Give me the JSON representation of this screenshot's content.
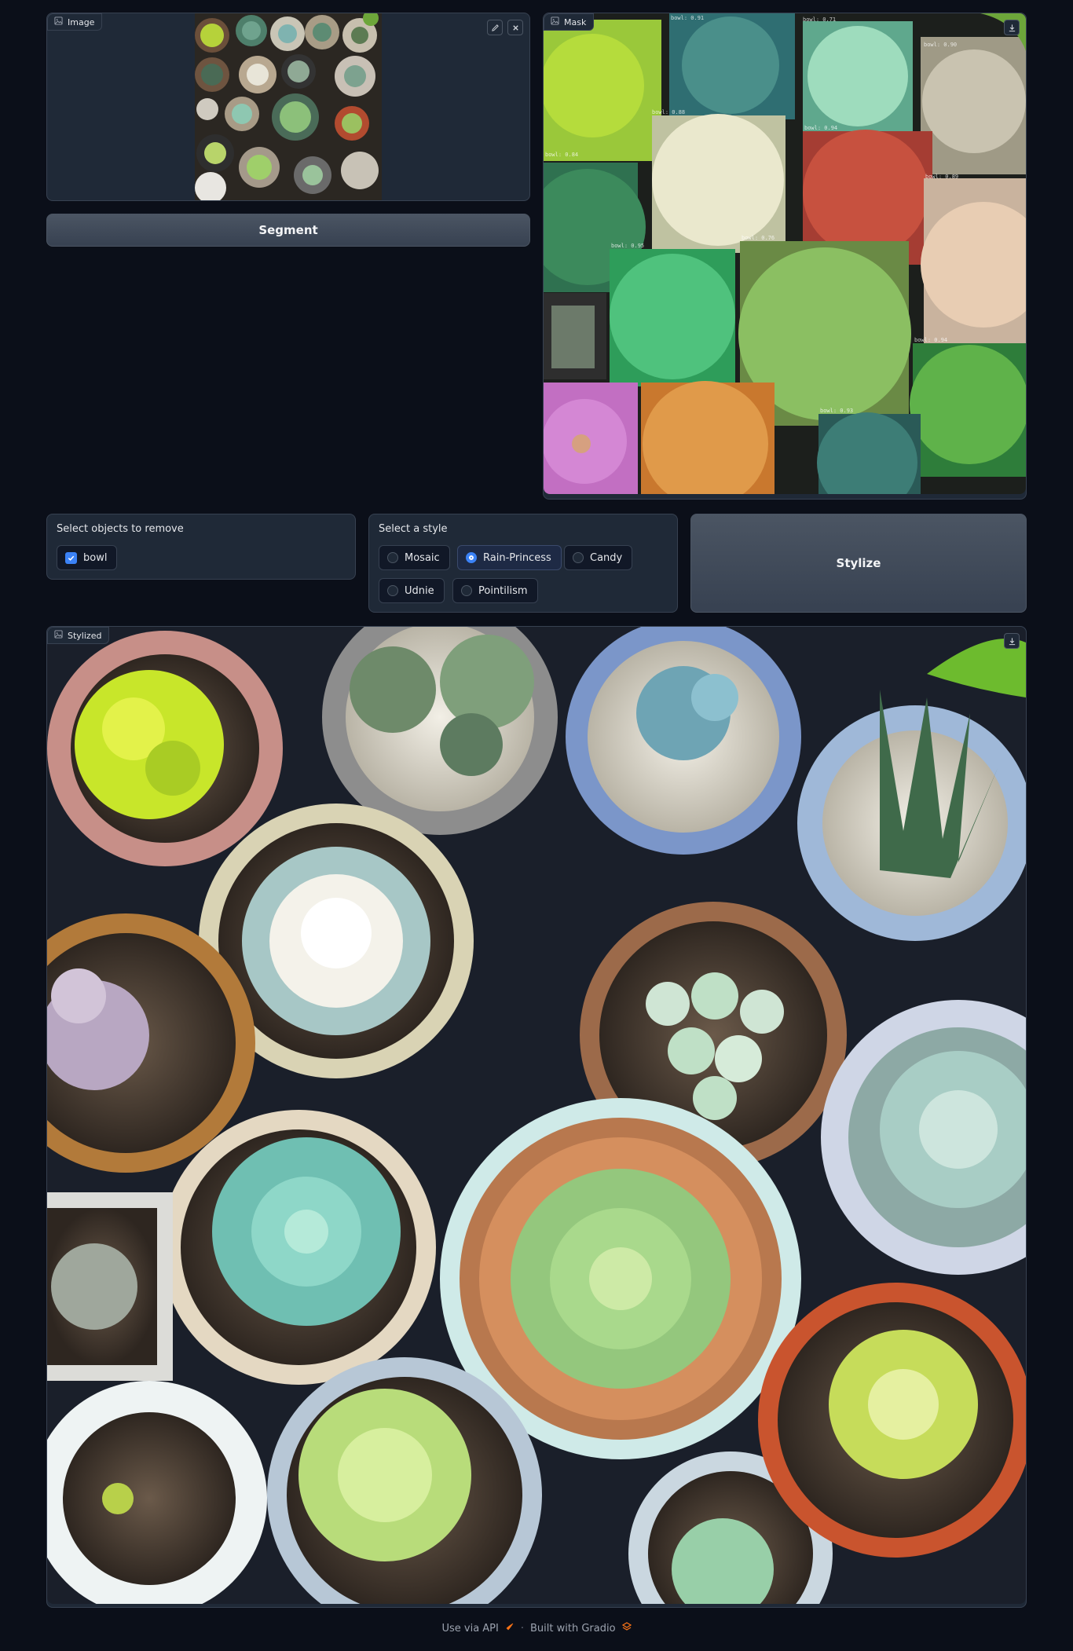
{
  "image_panel": {
    "label": "Image",
    "icon": "image-icon",
    "edit_icon": "pencil-icon",
    "clear_icon": "close-icon"
  },
  "segment_button": {
    "label": "Segment"
  },
  "mask_panel": {
    "label": "Mask",
    "download_icon": "download-icon",
    "score_labels": [
      "bowl: 0.91",
      "bowl: 0.71",
      "bowl: 0.90",
      "bowl: 0.84",
      "bowl: 0.88",
      "bowl: 0.94",
      "bowl: 0.89",
      "bowl: 0.95",
      "bowl: 0.76",
      "bowl: 0.94",
      "bowl: 0.93"
    ]
  },
  "remove_group": {
    "title": "Select objects to remove",
    "options": [
      {
        "label": "bowl",
        "checked": true
      }
    ]
  },
  "style_group": {
    "title": "Select a style",
    "options": [
      {
        "label": "Mosaic",
        "selected": false
      },
      {
        "label": "Rain-Princess",
        "selected": true
      },
      {
        "label": "Candy",
        "selected": false
      },
      {
        "label": "Udnie",
        "selected": false
      },
      {
        "label": "Pointilism",
        "selected": false
      }
    ]
  },
  "stylize_button": {
    "label": "Stylize"
  },
  "stylized_panel": {
    "label": "Stylized",
    "icon": "image-icon",
    "download_icon": "download-icon"
  },
  "footer": {
    "api_label": "Use via API",
    "separator": "·",
    "built_label": "Built with Gradio",
    "api_icon": "rocket-icon",
    "gradio_icon": "gradio-logo-icon"
  },
  "colors": {
    "accent": "#3b82f6",
    "gradio": "#f97316",
    "background": "#0b0f19"
  }
}
